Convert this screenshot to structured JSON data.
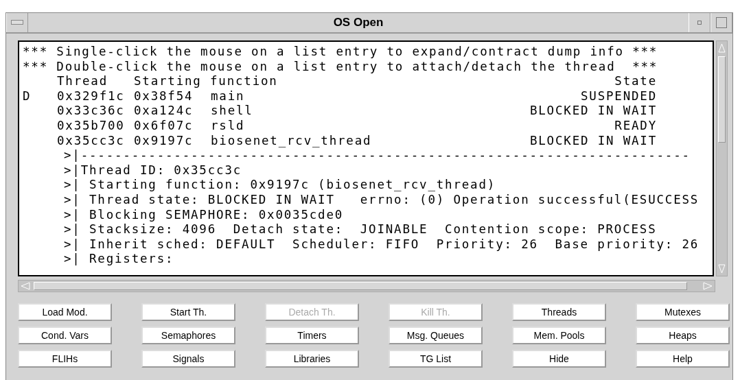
{
  "window": {
    "title": "OS Open"
  },
  "list": {
    "instructions": [
      "*** Single-click the mouse on a list entry to expand/contract dump info ***",
      "*** Double-click the mouse on a list entry to attach/detach the thread  ***"
    ],
    "columns": {
      "thread": "Thread",
      "starting_function": "Starting function",
      "state": "State"
    },
    "threads": [
      {
        "marker": "D",
        "thread": "0x329f1c",
        "start": "0x38f54",
        "function": "main",
        "state": "SUSPENDED"
      },
      {
        "thread": "0x33c36c",
        "start": "0xa124c",
        "function": "shell",
        "state": "BLOCKED IN WAIT"
      },
      {
        "thread": "0x35b700",
        "start": "0x6f07c",
        "function": "rsld",
        "state": "READY"
      },
      {
        "thread": "0x35cc3c",
        "start": "0x9197c",
        "function": "biosenet_rcv_thread",
        "state": "BLOCKED IN WAIT"
      }
    ],
    "details": [
      ">|------------------------------------------------------------------------",
      ">|Thread ID: 0x35cc3c",
      ">| Starting function: 0x9197c (biosenet_rcv_thread)",
      ">| Thread state: BLOCKED IN WAIT   errno: (0) Operation successful(ESUCCESS",
      ">| Blocking SEMAPHORE: 0x0035cde0",
      ">| Stacksize: 4096  Detach state:  JOINABLE  Contention scope: PROCESS",
      ">| Inherit sched: DEFAULT  Scheduler: FIFO  Priority: 26  Base priority: 26",
      ">| Registers:"
    ]
  },
  "buttons": [
    {
      "label": "Load Mod.",
      "disabled": false
    },
    {
      "label": "Start Th.",
      "disabled": false
    },
    {
      "label": "Detach Th.",
      "disabled": true
    },
    {
      "label": "Kill Th.",
      "disabled": true
    },
    {
      "label": "Threads",
      "disabled": false
    },
    {
      "label": "Mutexes",
      "disabled": false
    },
    {
      "label": "Cond. Vars",
      "disabled": false
    },
    {
      "label": "Semaphores",
      "disabled": false
    },
    {
      "label": "Timers",
      "disabled": false
    },
    {
      "label": "Msg. Queues",
      "disabled": false
    },
    {
      "label": "Mem. Pools",
      "disabled": false
    },
    {
      "label": "Heaps",
      "disabled": false
    },
    {
      "label": "FLIHs",
      "disabled": false
    },
    {
      "label": "Signals",
      "disabled": false
    },
    {
      "label": "Libraries",
      "disabled": false
    },
    {
      "label": "TG List",
      "disabled": false
    },
    {
      "label": "Hide",
      "disabled": false
    },
    {
      "label": "Help",
      "disabled": false
    }
  ]
}
